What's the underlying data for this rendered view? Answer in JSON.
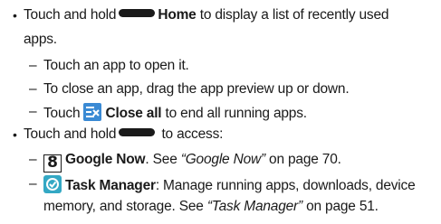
{
  "bullets": [
    {
      "line1_pre": "Touch and hold",
      "line1_bold": "Home",
      "line1_post": " to display a list of recently used",
      "line2": "apps.",
      "subitems": [
        {
          "text": "Touch an app to open it."
        },
        {
          "text": "To close an app, drag the app preview up or down."
        },
        {
          "pre": "Touch ",
          "icon": "close-all-icon",
          "bold": "Close all",
          "post": " to end all running apps."
        }
      ]
    },
    {
      "line1_pre": "Touch and hold",
      "line1_post": " to access:",
      "subitems": [
        {
          "icon": "google-now-icon",
          "icon_glyph": "8",
          "bold": "Google Now",
          "post": ". See ",
          "ital": "“Google Now”",
          "post2": " on page 70."
        },
        {
          "icon": "task-manager-icon",
          "bold": "Task Manager",
          "post": ": Manage running apps, downloads, device",
          "line2_pre": "memory, and storage. See ",
          "line2_ital": "“Task Manager”",
          "line2_post": " on page 51."
        }
      ]
    }
  ]
}
